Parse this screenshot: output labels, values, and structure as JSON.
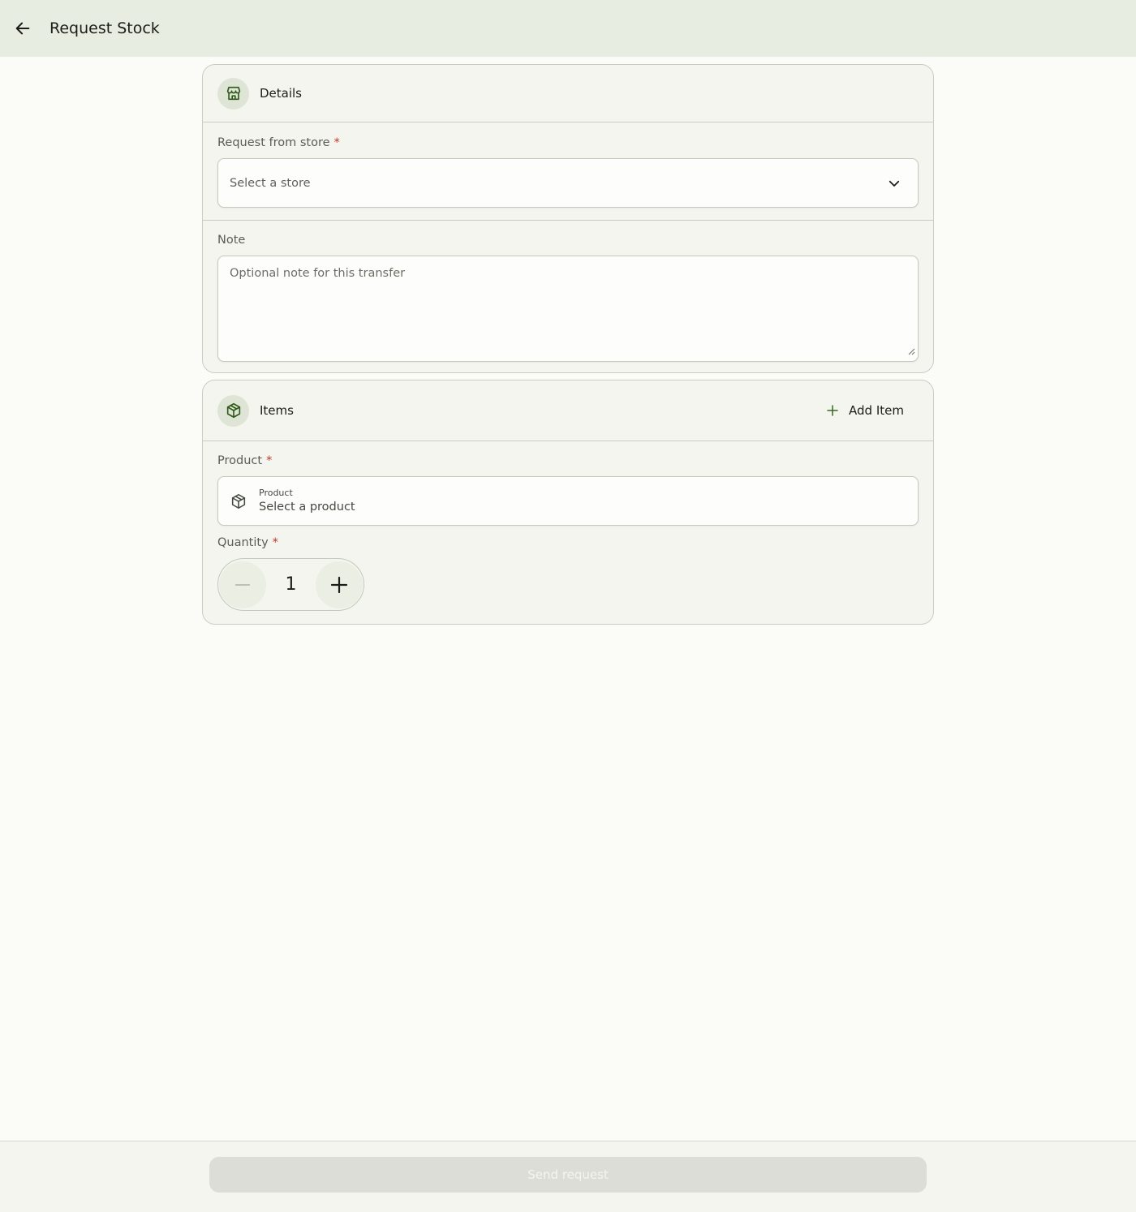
{
  "app_bar": {
    "title": "Request Stock",
    "back_icon": "arrow-left-icon"
  },
  "details_card": {
    "title": "Details",
    "icon": "store-icon",
    "store_field": {
      "label": "Request from store",
      "required_mark": "*",
      "placeholder": "Select a store"
    },
    "note_field": {
      "label": "Note",
      "placeholder": "Optional note for this transfer"
    }
  },
  "items_card": {
    "title": "Items",
    "icon": "package-icon",
    "add_item_label": "Add Item",
    "product_field": {
      "label": "Product",
      "required_mark": "*",
      "inner_label": "Product",
      "placeholder": "Select a product"
    },
    "quantity_field": {
      "label": "Quantity",
      "required_mark": "*",
      "value": "1"
    }
  },
  "footer": {
    "send_label": "Send request",
    "send_enabled": false
  },
  "colors": {
    "app_bar_bg": "#e8ede2",
    "page_bg": "#fbfcf8",
    "card_bg": "#f3f5ee",
    "accent": "#386a20",
    "required": "#c0362c",
    "disabled_button": "#dcddd6"
  }
}
